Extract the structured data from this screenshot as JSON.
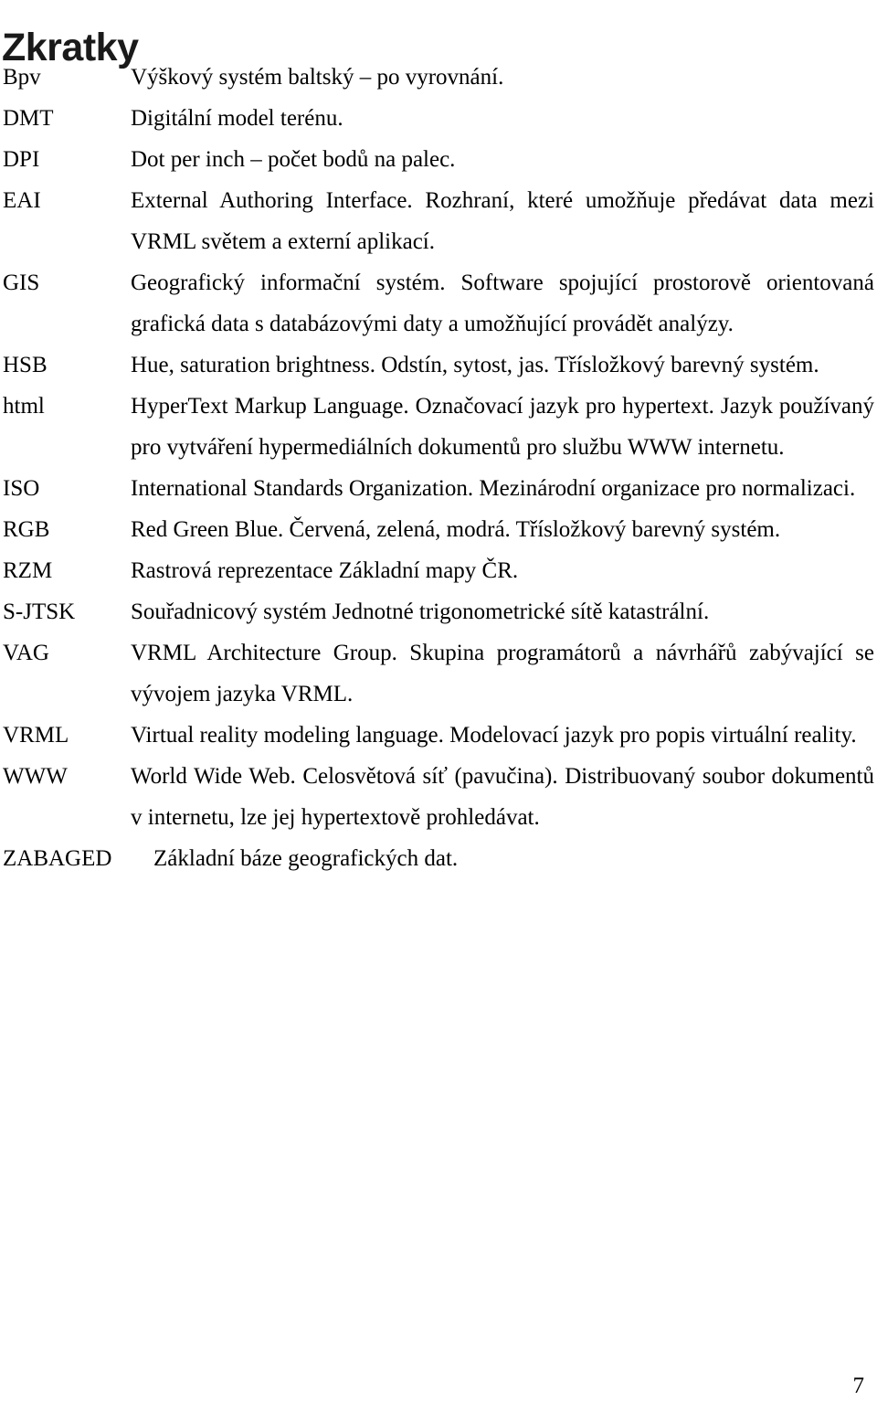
{
  "document": {
    "title": "Zkratky",
    "page_number": "7",
    "text_color": "#000000",
    "background_color": "#ffffff"
  },
  "glossary": {
    "entries": [
      {
        "term": "Bpv",
        "definition": "Výškový systém baltský – po vyrovnání.",
        "justified": false
      },
      {
        "term": "DMT",
        "definition": "Digitální model terénu.",
        "justified": false
      },
      {
        "term": "DPI",
        "definition": "Dot per inch – počet bodů na palec.",
        "justified": false
      },
      {
        "term": "EAI",
        "definition": "External Authoring Interface. Rozhraní, které umožňuje předávat data mezi VRML světem a externí aplikací.",
        "justified": true
      },
      {
        "term": "GIS",
        "definition": "Geografický informační systém. Software spojující prostorově orientovaná grafická data s databázovými daty a umožňující provádět analýzy.",
        "justified": true
      },
      {
        "term": "HSB",
        "definition": "Hue, saturation brightness. Odstín, sytost, jas. Třísložkový barevný systém.",
        "justified": false
      },
      {
        "term": "html",
        "definition": "HyperText Markup Language. Označovací jazyk pro hypertext. Jazyk používaný pro vytváření hypermediálních dokumentů pro službu WWW internetu.",
        "justified": true
      },
      {
        "term": "ISO",
        "definition": "International Standards Organization. Mezinárodní organizace pro normalizaci.",
        "justified": true
      },
      {
        "term": "RGB",
        "definition": "Red Green Blue. Červená, zelená, modrá. Třísložkový barevný systém.",
        "justified": false
      },
      {
        "term": "RZM",
        "definition": "Rastrová reprezentace Základní mapy ČR.",
        "justified": false
      },
      {
        "term": "S-JTSK",
        "definition": "Souřadnicový systém Jednotné trigonometrické sítě katastrální.",
        "justified": false
      },
      {
        "term": "VAG",
        "definition": "VRML Architecture Group. Skupina programátorů a návrhářů zabývající se vývojem jazyka VRML.",
        "justified": true
      },
      {
        "term": "VRML",
        "definition": "Virtual reality modeling language. Modelovací jazyk pro popis virtuální reality.",
        "justified": true
      },
      {
        "term": "WWW",
        "definition": "World Wide Web. Celosvětová síť (pavučina). Distribuovaný soubor dokumentů v internetu, lze jej hypertextově prohledávat.",
        "justified": true
      },
      {
        "term": "ZABAGED",
        "definition": "Základní báze geografických dat.",
        "justified": false,
        "wide_term": true
      }
    ]
  }
}
